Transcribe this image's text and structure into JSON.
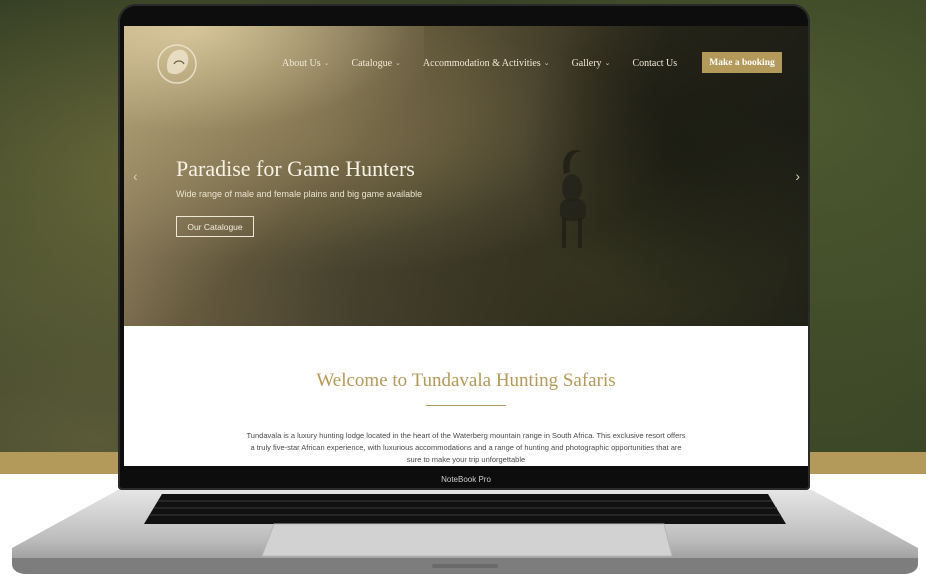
{
  "nav": {
    "items": [
      {
        "label": "About Us",
        "has_dropdown": true
      },
      {
        "label": "Catalogue",
        "has_dropdown": true
      },
      {
        "label": "Accommodation & Activities",
        "has_dropdown": true
      },
      {
        "label": "Gallery",
        "has_dropdown": true
      },
      {
        "label": "Contact Us",
        "has_dropdown": false
      }
    ],
    "chevron": "⌄",
    "cta_label": "Make a booking"
  },
  "hero": {
    "title": "Paradise for Game Hunters",
    "subtitle": "Wide range of male and female plains and big game available",
    "button_label": "Our Catalogue",
    "prev_arrow": "‹",
    "next_arrow": "›"
  },
  "welcome": {
    "heading": "Welcome to Tundavala Hunting Safaris",
    "text": "Tundavala is a luxury hunting lodge located in the heart of the Waterberg mountain range in South Africa. This exclusive resort offers a truly five-star African experience, with luxurious accommodations and a range of hunting and photographic opportunities that are sure to make your trip unforgettable"
  },
  "device": {
    "model_label": "NoteBook Pro"
  },
  "colors": {
    "accent_gold": "#b49a5a",
    "hero_text": "#f7f2e6",
    "body_text": "#4a4a4a"
  },
  "icons": {
    "logo": "lion-head-logo-icon",
    "prev": "chevron-left-icon",
    "next": "chevron-right-icon"
  }
}
